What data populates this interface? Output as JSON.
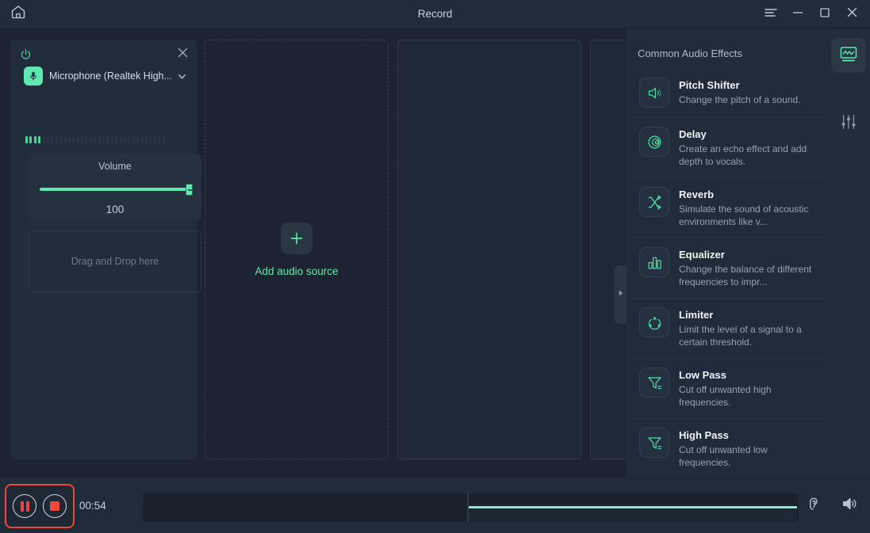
{
  "window": {
    "title": "Record",
    "home_icon": "home-icon",
    "menu_icon": "hamburger-menu-icon",
    "minimize_icon": "minimize-icon",
    "maximize_icon": "maximize-icon",
    "close_icon": "close-icon"
  },
  "colors": {
    "accent": "#5fe8b0",
    "record_red": "#f2463c",
    "panel_bg": "#222d3b",
    "app_bg": "#1b2430",
    "titlebar_bg": "#212c3a",
    "text_primary": "#eef3f7",
    "text_secondary": "#96a2ae"
  },
  "left_panel": {
    "power_icon": "power-icon",
    "close_icon": "close-icon",
    "device_icon": "microphone-icon",
    "device_name": "Microphone (Realtek High...",
    "dropdown_icon": "chevron-down-icon",
    "meter": {
      "total_segments": 33,
      "lit_segments": 4
    },
    "volume_label": "Volume",
    "volume_value": "100",
    "volume_percent": 100,
    "dragdrop_label": "Drag and Drop here"
  },
  "center": {
    "add_source_label": "Add audio source",
    "plus_icon": "plus-icon",
    "collapse_icon": "chevron-right-icon"
  },
  "effects": {
    "title": "Common Audio Effects",
    "items": [
      {
        "name": "Pitch Shifter",
        "desc": "Change the pitch of a sound.",
        "icon": "speaker-pitch-icon"
      },
      {
        "name": "Delay",
        "desc": "Create an echo effect and add depth to vocals.",
        "icon": "echo-rings-icon"
      },
      {
        "name": "Reverb",
        "desc": "Simulate the sound of acoustic environments like v...",
        "icon": "shuffle-arrows-icon"
      },
      {
        "name": "Equalizer",
        "desc": "Change the balance of different frequencies to impr...",
        "icon": "bar-levels-icon"
      },
      {
        "name": "Limiter",
        "desc": "Limit the level of a signal to a certain threshold.",
        "icon": "limiter-circle-icon"
      },
      {
        "name": "Low Pass",
        "desc": "Cut off unwanted high frequencies.",
        "icon": "filter-funnel-icon"
      },
      {
        "name": "High Pass",
        "desc": "Cut off unwanted low frequencies.",
        "icon": "filter-funnel-icon"
      }
    ]
  },
  "rail": {
    "items": [
      {
        "icon": "waveform-monitor-icon",
        "active": true
      },
      {
        "icon": "sliders-icon",
        "active": false
      }
    ]
  },
  "bottom": {
    "pause_icon": "pause-icon",
    "stop_icon": "stop-icon",
    "timecode": "00:54",
    "monitor_icon": "ear-icon",
    "speaker_icon": "speaker-icon"
  }
}
